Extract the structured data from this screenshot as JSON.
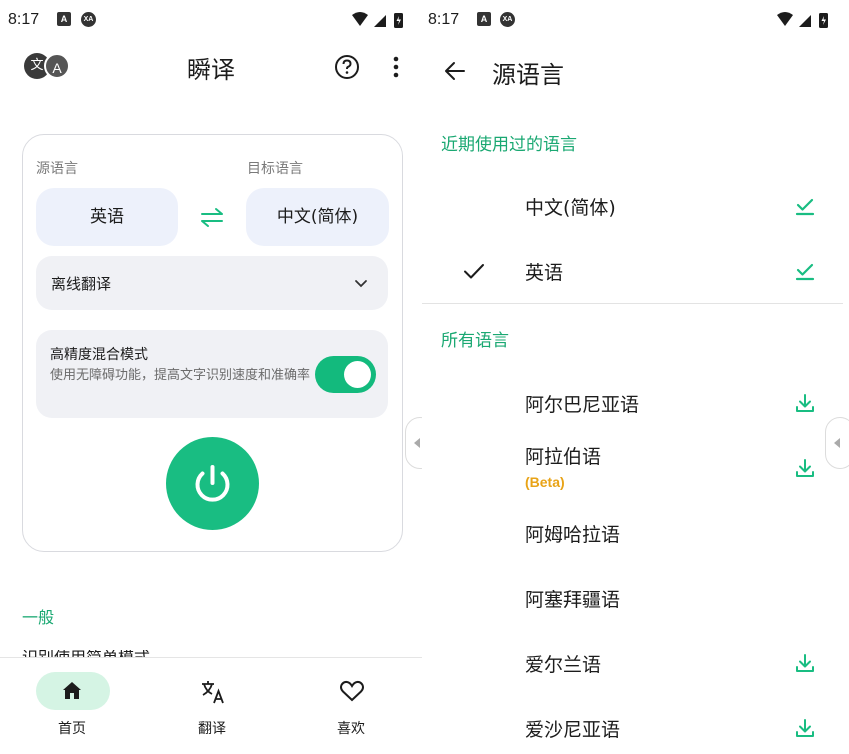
{
  "left": {
    "status": {
      "time": "8:17",
      "badge1": "A",
      "badge2": "XA"
    },
    "logo": {
      "a": "文",
      "b": "A"
    },
    "title": "瞬译",
    "source_label": "源语言",
    "target_label": "目标语言",
    "source_lang": "英语",
    "target_lang": "中文(简体)",
    "mode_select": "离线翻译",
    "mix_title": "高精度混合模式",
    "mix_desc": "使用无障碍功能，提高文字识别速度和准确率",
    "mix_enabled": true,
    "section_general": "一般",
    "cut_text": "识别使用简单模式",
    "nav": [
      {
        "label": "首页",
        "icon": "home-icon",
        "active": true
      },
      {
        "label": "翻译",
        "icon": "translate-icon",
        "active": false
      },
      {
        "label": "喜欢",
        "icon": "heart-icon",
        "active": false
      }
    ]
  },
  "right": {
    "status": {
      "time": "8:17",
      "badge1": "A",
      "badge2": "XA"
    },
    "title": "源语言",
    "recent_header": "近期使用过的语言",
    "all_header": "所有语言",
    "recent": [
      {
        "name": "中文(简体)",
        "selected": false,
        "status": "downloaded"
      },
      {
        "name": "英语",
        "selected": true,
        "status": "downloaded"
      }
    ],
    "all": [
      {
        "name": "阿尔巴尼亚语",
        "tag": "",
        "status": "download"
      },
      {
        "name": "阿拉伯语",
        "tag": "(Beta)",
        "status": "download"
      },
      {
        "name": "阿姆哈拉语",
        "tag": "",
        "status": ""
      },
      {
        "name": "阿塞拜疆语",
        "tag": "",
        "status": ""
      },
      {
        "name": "爱尔兰语",
        "tag": "",
        "status": "download"
      },
      {
        "name": "爱沙尼亚语",
        "tag": "",
        "status": "download"
      }
    ]
  },
  "colors": {
    "accent": "#19bd82",
    "accent_text": "#1aa872",
    "beta": "#e8a317",
    "chip_bg": "#edf1fb"
  }
}
